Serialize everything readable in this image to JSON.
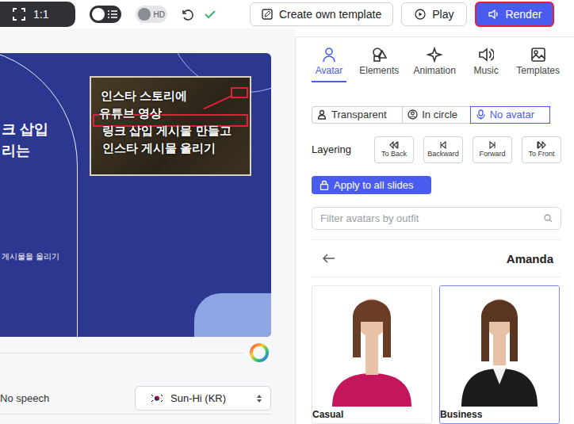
{
  "toolbar": {
    "aspect": "1:1",
    "list_toggle_on": true,
    "hd_label": "HD",
    "hd_on": false,
    "create_template": "Create own template",
    "play": "Play",
    "render": "Render"
  },
  "slide": {
    "title_lines": [
      "크 삽입",
      "리는"
    ],
    "footer": "게시물을 올리기",
    "image_caption": [
      "인스타 스토리에",
      "유튜브 영상",
      "링크 삽입 게시물 만들고",
      "인스타 게시물 올리기"
    ]
  },
  "speech": {
    "label": "No speech",
    "voice": "Sun-Hi (KR)"
  },
  "panel": {
    "tabs": [
      {
        "label": "Avatar",
        "selected": true
      },
      {
        "label": "Elements",
        "selected": false
      },
      {
        "label": "Animation",
        "selected": false
      },
      {
        "label": "Music",
        "selected": false
      },
      {
        "label": "Templates",
        "selected": false
      }
    ],
    "avatar_modes": [
      {
        "label": "Transparent",
        "selected": false
      },
      {
        "label": "In circle",
        "selected": false
      },
      {
        "label": "No avatar",
        "selected": true
      }
    ],
    "layering": {
      "label": "Layering",
      "buttons": [
        "To Back",
        "Backward",
        "Forward",
        "To Front"
      ]
    },
    "apply": "Apply to all slides",
    "filter_placeholder": "Filter avatars by outfit",
    "avatar_name": "Amanda",
    "outfits": [
      {
        "label": "Casual",
        "selected": false
      },
      {
        "label": "Business",
        "selected": true
      }
    ]
  }
}
